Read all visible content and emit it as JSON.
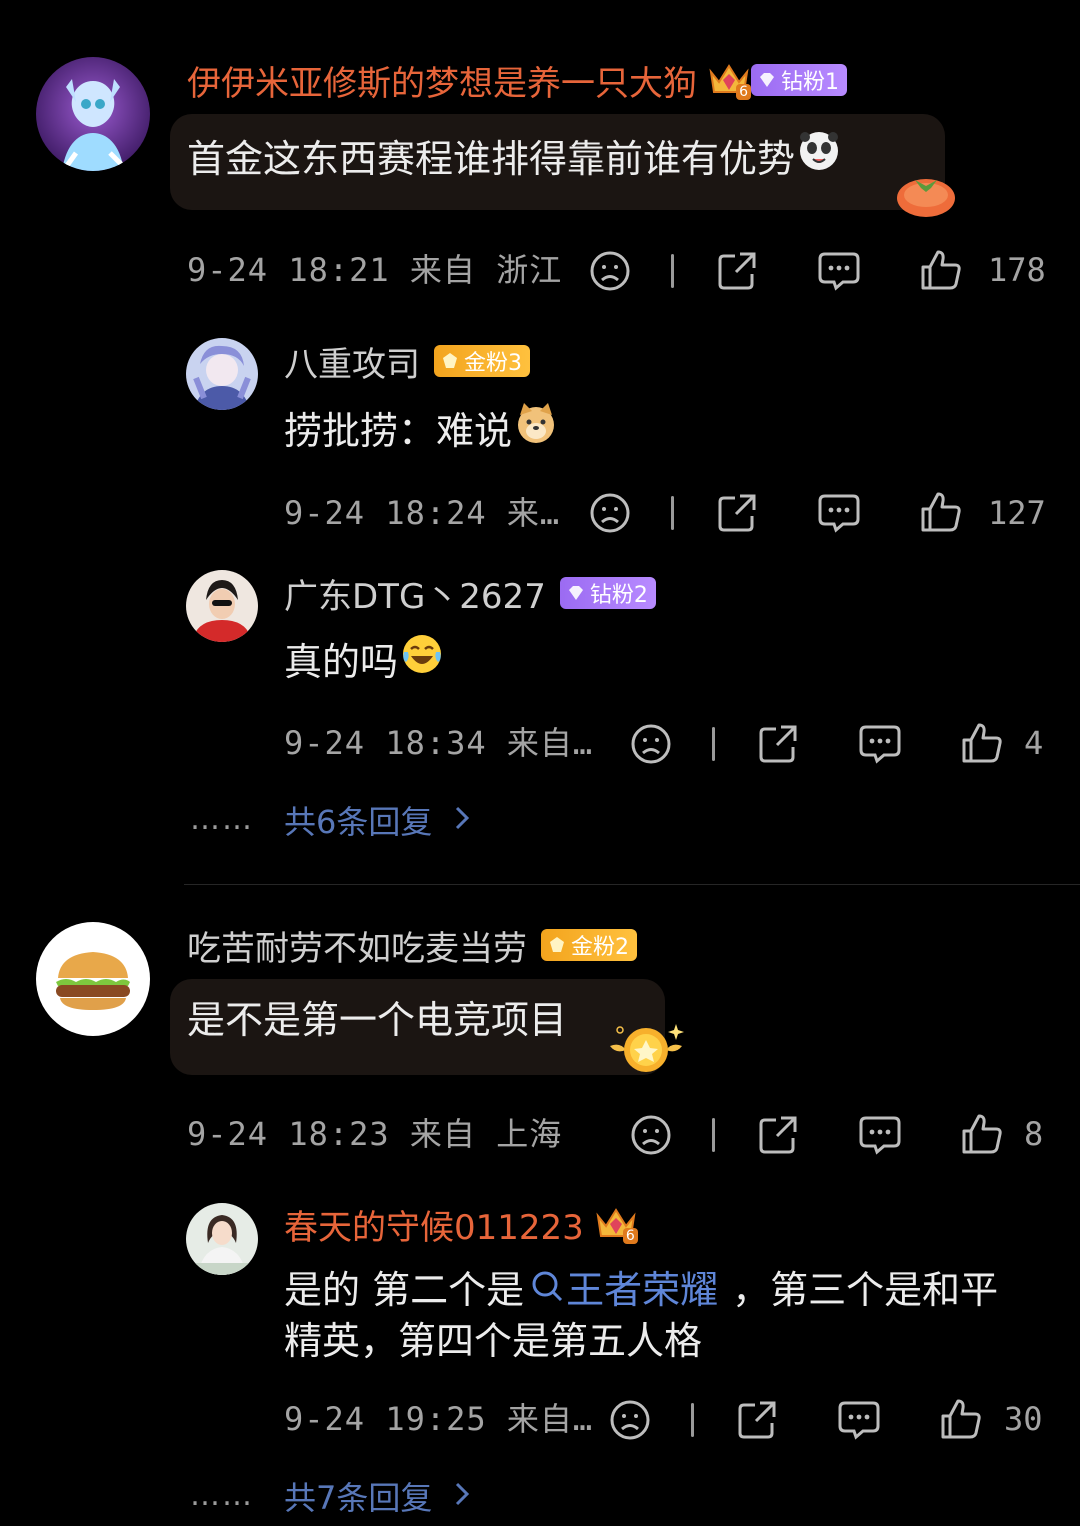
{
  "comments": [
    {
      "user": "伊伊米亚修斯的梦想是养一只大狗",
      "level_badge": "6",
      "fan_badge": "钻粉1",
      "text": "首金这东西赛程谁排得靠前谁有优势",
      "meta": "9-24 18:21 来自 浙江",
      "likes": "178",
      "replies": [
        {
          "user": "八重攻司",
          "fan_badge": "金粉3",
          "text": "捞批捞：难说",
          "meta": "9-24 18:24 来…",
          "likes": "127"
        },
        {
          "user": "广东DTG丶2627",
          "fan_badge": "钻粉2",
          "text": "真的吗",
          "meta": "9-24 18:34 来自…",
          "likes": "4"
        }
      ],
      "more_dots": "……",
      "more_replies": "共6条回复"
    },
    {
      "user": "吃苦耐劳不如吃麦当劳",
      "fan_badge": "金粉2",
      "text": "是不是第一个电竞项目",
      "meta": "9-24 18:23 来自 上海",
      "likes": "8",
      "replies": [
        {
          "user": "春天的守候011223",
          "level_badge": "6",
          "text_part1": "是的 第二个是",
          "link_text": "王者荣耀",
          "text_part2": "，第三个是和平",
          "text_line2": "精英，第四个是第五人格",
          "meta": "9-24 19:25 来自…",
          "likes": "30"
        }
      ],
      "more_dots": "……",
      "more_replies": "共7条回复"
    }
  ],
  "colors": {
    "name_vip": "#e7653a",
    "link": "#5f86d8",
    "diamond_badge": "#a97cf8",
    "gold_badge": "#f7b02c"
  },
  "icons": [
    "sad-face-icon",
    "share-icon",
    "comment-icon",
    "thumbs-up-icon",
    "chevron-right-icon",
    "search-icon",
    "crown-icon",
    "persimmon-sticker-icon",
    "gold-medal-sticker-icon"
  ]
}
